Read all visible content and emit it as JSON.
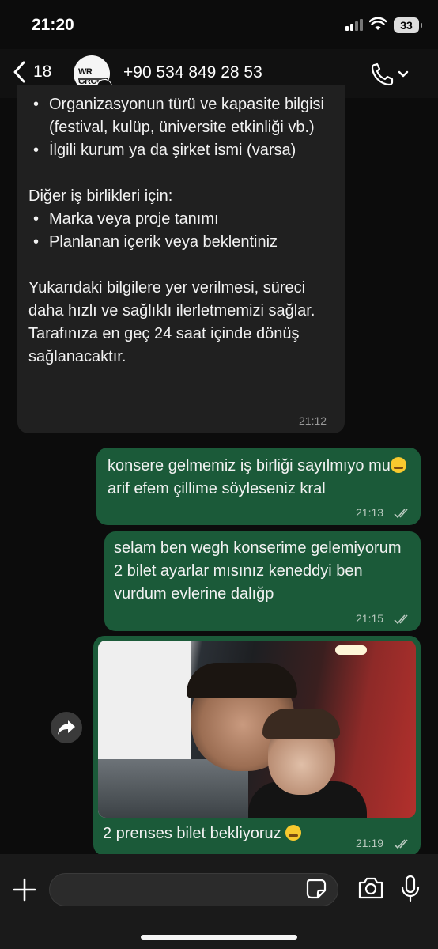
{
  "status_bar": {
    "time": "21:20",
    "battery": "33"
  },
  "header": {
    "back_count": "18",
    "contact": "+90 534 849 28 53",
    "avatar_logo": "WR GROUP"
  },
  "messages": {
    "m1": {
      "bullets_a": [
        "Organizasyonun türü ve kapasite bilgisi (festival, kulüp, üniversite etkinliği vb.)",
        "İlgili kurum ya da şirket ismi (varsa)"
      ],
      "heading": "Diğer iş birlikleri için:",
      "bullets_b": [
        "Marka veya proje tanımı",
        "Planlanan içerik veya beklentiniz"
      ],
      "paragraph": "Yukarıdaki bilgilere yer verilmesi, süreci daha hızlı ve sağlıklı ilerletmemizi sağlar. Tarafınıza en geç 24 saat içinde dönüş sağlanacaktır.",
      "time": "21:12"
    },
    "m2": {
      "text_a": "konsere gelmemiz iş birliği sayılmıyo mu",
      "text_b": " arif efem çillime söyleseniz kral",
      "time": "21:13"
    },
    "m3": {
      "text": "selam ben wegh konserime gelemiyorum 2 bilet ayarlar mısınız keneddyi ben vurdum evlerine dalığp",
      "time": "21:15"
    },
    "m4": {
      "caption": "2 prenses bilet bekliyoruz ",
      "time": "21:19"
    }
  },
  "icons": {
    "back": "chevron-left-icon",
    "call": "phone-icon",
    "share": "forward-icon",
    "plus": "plus-icon",
    "sticker": "sticker-icon",
    "camera": "camera-icon",
    "mic": "microphone-icon"
  },
  "colors": {
    "incoming_bubble": "#202020",
    "outgoing_bubble": "#1b5a39",
    "background": "#0b0b0b"
  }
}
